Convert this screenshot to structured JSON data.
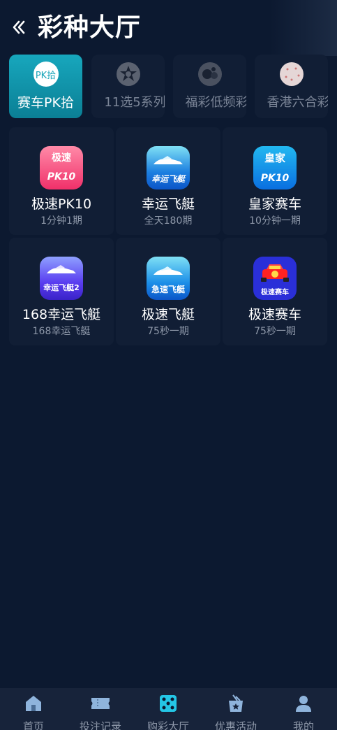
{
  "header": {
    "title": "彩种大厅"
  },
  "tabs": [
    {
      "label": "赛车PK拾",
      "icon": "pk-icon",
      "icon_text": "PK拾",
      "active": true
    },
    {
      "label": "11选5系列",
      "icon": "11x5-icon",
      "active": false
    },
    {
      "label": "福彩低频彩",
      "icon": "lottery-balls-icon",
      "active": false
    },
    {
      "label": "香港六合彩",
      "icon": "mark-six-icon",
      "active": false
    }
  ],
  "games": [
    {
      "name": "极速PK10",
      "desc": "1分钟1期",
      "logo_top": "极速",
      "logo_bottom": "PK10"
    },
    {
      "name": "幸运飞艇",
      "desc": "全天180期",
      "logo_text": "幸运飞艇"
    },
    {
      "name": "皇家赛车",
      "desc": "10分钟一期",
      "logo_top": "皇家",
      "logo_bottom": "PK10"
    },
    {
      "name": "168幸运飞艇",
      "desc": "168幸运飞艇",
      "logo_text": "幸运飞艇2"
    },
    {
      "name": "极速飞艇",
      "desc": "75秒一期",
      "logo_text": "急速飞艇"
    },
    {
      "name": "极速赛车",
      "desc": "75秒一期",
      "logo_text": "极速赛车"
    }
  ],
  "bottom_nav": [
    {
      "label": "首页",
      "icon": "home-icon"
    },
    {
      "label": "投注记录",
      "icon": "ticket-icon"
    },
    {
      "label": "购彩大厅",
      "icon": "dice-icon",
      "active": true
    },
    {
      "label": "优惠活动",
      "icon": "gift-icon"
    },
    {
      "label": "我的",
      "icon": "user-icon"
    }
  ],
  "colors": {
    "background": "#0c1930",
    "card": "#111e35",
    "accent": "#17a7bd",
    "muted_text": "#8f99aa"
  }
}
